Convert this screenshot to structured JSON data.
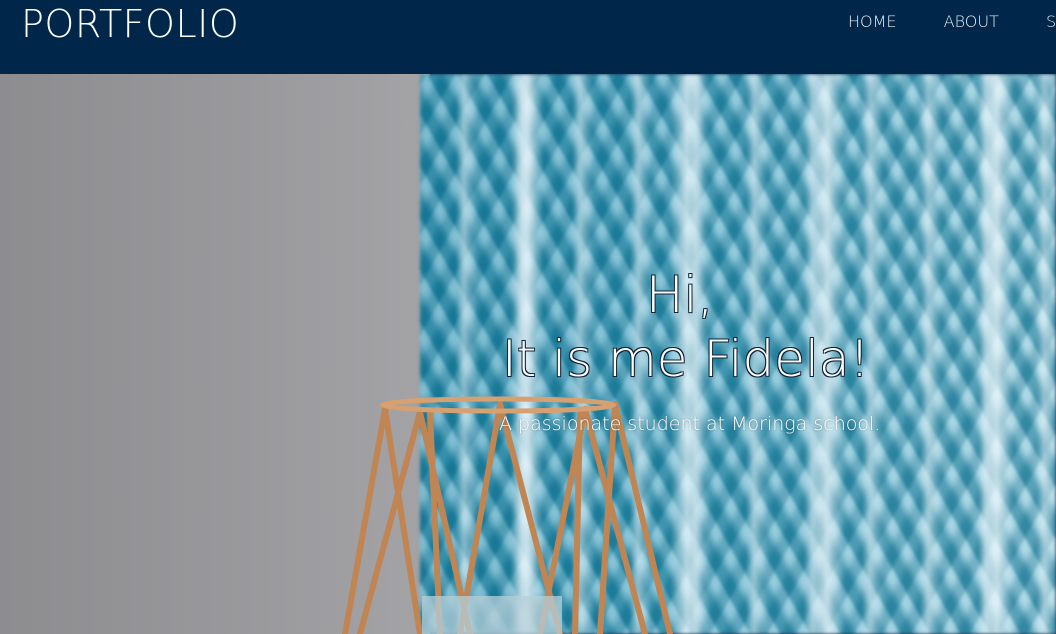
{
  "navbar": {
    "brand": "PORTFOLIO",
    "links": [
      {
        "label": "HOME"
      },
      {
        "label": "ABOUT"
      },
      {
        "label": "SK"
      }
    ]
  },
  "hero": {
    "greeting_line1": "Hi,",
    "greeting_line2": "It is me Fidela!",
    "tagline": "A passionate student at Moringa school."
  },
  "colors": {
    "navbar_bg": "#00264a",
    "nav_text": "#e8eef5",
    "hero_text": "#ffffff",
    "text_outline": "#0d2238"
  }
}
